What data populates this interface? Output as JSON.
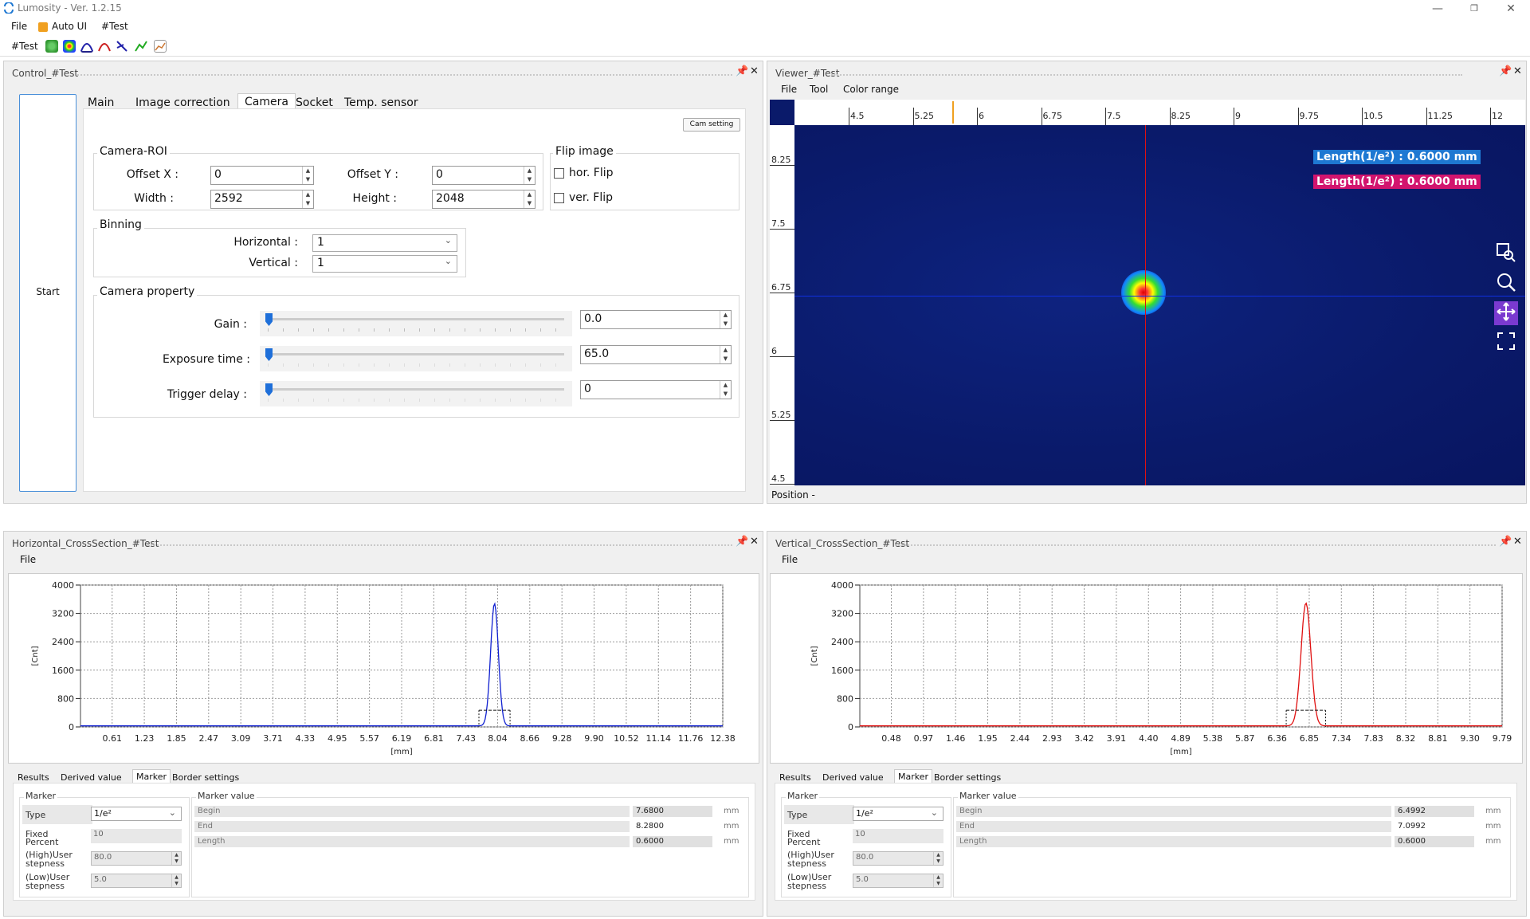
{
  "app": {
    "title": "Lumosity - Ver. 1.2.15"
  },
  "menu": {
    "file": "File",
    "auto_ui": "Auto UI",
    "test": "#Test"
  },
  "toolbar": {
    "label": "#Test"
  },
  "control": {
    "title": "Control_#Test",
    "start": "Start",
    "tabs": [
      "Main",
      "Image correction",
      "Camera",
      "Socket",
      "Temp. sensor"
    ],
    "active_tab": "Camera",
    "cam_setting": "Cam setting",
    "roi": {
      "title": "Camera-ROI",
      "offset_x_label": "Offset X :",
      "offset_x": "0",
      "offset_y_label": "Offset Y :",
      "offset_y": "0",
      "width_label": "Width :",
      "width": "2592",
      "height_label": "Height :",
      "height": "2048"
    },
    "flip": {
      "title": "Flip image",
      "hor": "hor. Flip",
      "ver": "ver. Flip"
    },
    "binning": {
      "title": "Binning",
      "h_label": "Horizontal :",
      "h_value": "1",
      "v_label": "Vertical :",
      "v_value": "1"
    },
    "property": {
      "title": "Camera property",
      "gain_label": "Gain :",
      "gain": "0.0",
      "exposure_label": "Exposure time :",
      "exposure": "65.0",
      "trigger_label": "Trigger delay :",
      "trigger": "0"
    }
  },
  "viewer": {
    "title": "Viewer_#Test",
    "menu": [
      "File",
      "Tool",
      "Color range"
    ],
    "hticks": [
      "4.5",
      "5.25",
      "6",
      "6.75",
      "7.5",
      "8.25",
      "9",
      "9.75",
      "10.5",
      "11.25",
      "12"
    ],
    "vticks": [
      "8.25",
      "7.5",
      "6.75",
      "6",
      "5.25",
      "4.5"
    ],
    "len1": "Length(1/e²) : 0.6000 mm",
    "len2": "Length(1/e²) : 0.6000 mm",
    "position": "Position -",
    "colors": {
      "len1_bg": "#1e78d2",
      "len2_bg": "#d2146e",
      "crosshair_v": "#e01010",
      "crosshair_h": "#1030e0",
      "bg": "#0a1a6a"
    }
  },
  "hcross": {
    "title": "Horizontal_CrossSection_#Test",
    "menu_file": "File",
    "tabs": [
      "Results",
      "Derived value",
      "Marker",
      "Border settings"
    ],
    "marker": {
      "group": "Marker",
      "type_label": "Type",
      "type_value": "1/e²",
      "fixed_label1": "Fixed",
      "fixed_label2": "Percent",
      "fixed_value": "10",
      "high_label1": "(High)User",
      "high_label2": "stepness",
      "high_value": "80.0",
      "low_label1": "(Low)User",
      "low_label2": "stepness",
      "low_value": "5.0",
      "value_group": "Marker value",
      "begin_label": "Begin",
      "begin": "7.6800",
      "end_label": "End",
      "end": "8.2800",
      "length_label": "Length",
      "length": "0.6000",
      "unit": "mm"
    }
  },
  "vcross": {
    "title": "Vertical_CrossSection_#Test",
    "menu_file": "File",
    "tabs": [
      "Results",
      "Derived value",
      "Marker",
      "Border settings"
    ],
    "marker": {
      "group": "Marker",
      "type_label": "Type",
      "type_value": "1/e²",
      "fixed_label1": "Fixed",
      "fixed_label2": "Percent",
      "fixed_value": "10",
      "high_label1": "(High)User",
      "high_label2": "stepness",
      "high_value": "80.0",
      "low_label1": "(Low)User",
      "low_label2": "stepness",
      "low_value": "5.0",
      "value_group": "Marker value",
      "begin_label": "Begin",
      "begin": "6.4992",
      "end_label": "End",
      "end": "7.0992",
      "length_label": "Length",
      "length": "0.6000",
      "unit": "mm"
    }
  },
  "chart_data": [
    {
      "type": "line",
      "xlabel": "[mm]",
      "ylabel": "[Cnt]",
      "xlim": [
        0.0,
        12.38
      ],
      "ylim": [
        0,
        4000
      ],
      "xticks": [
        "0.61",
        "1.23",
        "1.85",
        "2.47",
        "3.09",
        "3.71",
        "4.33",
        "4.95",
        "5.57",
        "6.19",
        "6.81",
        "7.43",
        "8.04",
        "8.66",
        "9.28",
        "9.90",
        "10.52",
        "11.14",
        "11.76",
        "12.38"
      ],
      "yticks": [
        "0",
        "800",
        "1600",
        "2400",
        "3200",
        "4000"
      ],
      "grid": true,
      "series": [
        {
          "color": "#1020d0",
          "peak_x": 7.98,
          "peak_y": 3450,
          "width": 0.3,
          "baseline": 30
        }
      ],
      "marker_begin": 7.68,
      "marker_end": 8.28,
      "marker_level": 470
    },
    {
      "type": "line",
      "xlabel": "[mm]",
      "ylabel": "[Cnt]",
      "xlim": [
        0.0,
        9.79
      ],
      "ylim": [
        0,
        4000
      ],
      "xticks": [
        "0.48",
        "0.97",
        "1.46",
        "1.95",
        "2.44",
        "2.93",
        "3.42",
        "3.91",
        "4.40",
        "4.89",
        "5.38",
        "5.87",
        "6.36",
        "6.85",
        "7.34",
        "7.83",
        "8.32",
        "8.81",
        "9.30",
        "9.79"
      ],
      "yticks": [
        "0",
        "800",
        "1600",
        "2400",
        "3200",
        "4000"
      ],
      "grid": true,
      "series": [
        {
          "color": "#e01010",
          "peak_x": 6.8,
          "peak_y": 3460,
          "width": 0.3,
          "baseline": 30
        }
      ],
      "marker_begin": 6.4992,
      "marker_end": 7.0992,
      "marker_level": 470
    }
  ]
}
